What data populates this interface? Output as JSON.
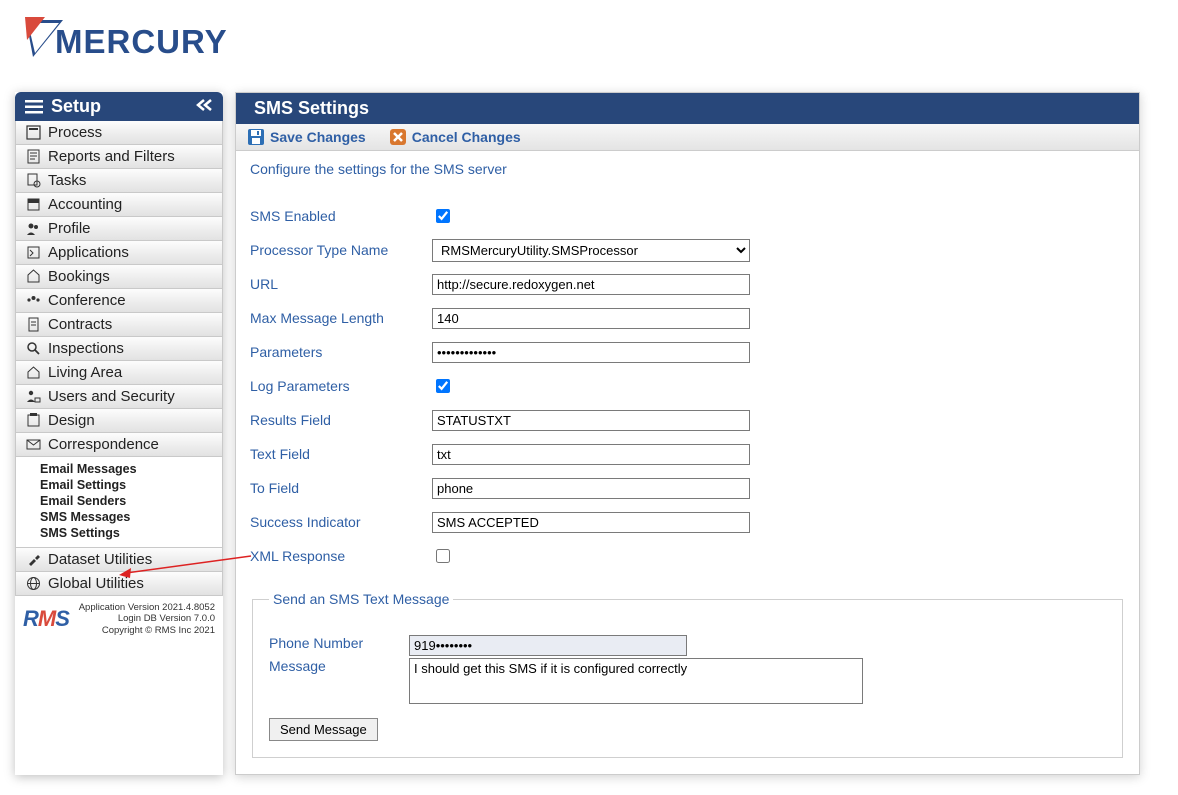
{
  "header": {
    "title": "Setup"
  },
  "panel": {
    "title": "SMS Settings"
  },
  "toolbar": {
    "save_label": "Save Changes",
    "cancel_label": "Cancel Changes"
  },
  "intro": "Configure the settings for the SMS server",
  "sidebar": {
    "items": [
      {
        "label": "Process"
      },
      {
        "label": "Reports and Filters"
      },
      {
        "label": "Tasks"
      },
      {
        "label": "Accounting"
      },
      {
        "label": "Profile"
      },
      {
        "label": "Applications"
      },
      {
        "label": "Bookings"
      },
      {
        "label": "Conference"
      },
      {
        "label": "Contracts"
      },
      {
        "label": "Inspections"
      },
      {
        "label": "Living Area"
      },
      {
        "label": "Users and Security"
      },
      {
        "label": "Design"
      },
      {
        "label": "Correspondence"
      },
      {
        "label": "Dataset Utilities"
      },
      {
        "label": "Global Utilities"
      }
    ],
    "submenu": [
      "Email Messages",
      "Email Settings",
      "Email Senders",
      "SMS Messages",
      "SMS Settings"
    ]
  },
  "form": {
    "sms_enabled_label": "SMS Enabled",
    "processor_label": "Processor Type Name",
    "processor_value": "RMSMercuryUtility.SMSProcessor",
    "url_label": "URL",
    "url_value": "http://secure.redoxygen.net",
    "maxlen_label": "Max Message Length",
    "maxlen_value": "140",
    "params_label": "Parameters",
    "params_value": "•••••••••••••",
    "logparams_label": "Log Parameters",
    "results_label": "Results Field",
    "results_value": "STATUSTXT",
    "text_label": "Text Field",
    "text_value": "txt",
    "to_label": "To Field",
    "to_value": "phone",
    "success_label": "Success Indicator",
    "success_value": "SMS ACCEPTED",
    "xml_label": "XML Response"
  },
  "fieldset": {
    "legend": "Send an SMS Text Message",
    "phone_label": "Phone Number",
    "phone_value": "919••••••••",
    "message_label": "Message",
    "message_value": "I should get this SMS if it is configured correctly",
    "send_button": "Send Message"
  },
  "footer": {
    "line1": "Application Version 2021.4.8052",
    "line2": "Login DB Version 7.0.0",
    "line3": "Copyright © RMS Inc 2021"
  }
}
